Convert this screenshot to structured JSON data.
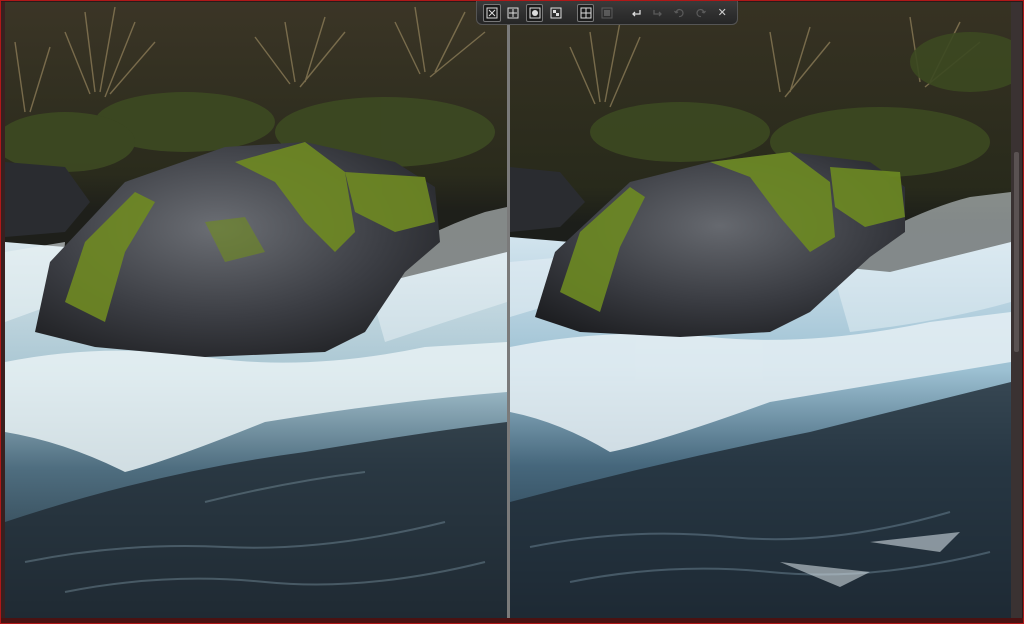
{
  "window": {
    "accent_color": "#b01818"
  },
  "toolbar": {
    "buttons": [
      {
        "id": "fit",
        "icon": "fit-view-icon",
        "boxed": true,
        "enabled": true
      },
      {
        "id": "zoom-100",
        "icon": "actual-size-icon",
        "boxed": false,
        "enabled": true
      },
      {
        "id": "single",
        "icon": "single-view-icon",
        "boxed": true,
        "enabled": true
      },
      {
        "id": "compare",
        "icon": "compare-view-icon",
        "boxed": false,
        "enabled": true
      },
      {
        "id": "split",
        "icon": "split-view-icon",
        "boxed": true,
        "enabled": true
      },
      {
        "id": "grid",
        "icon": "grid-view-icon",
        "boxed": false,
        "enabled": false
      },
      {
        "id": "prev",
        "icon": "previous-icon",
        "boxed": false,
        "enabled": true
      },
      {
        "id": "next",
        "icon": "next-icon",
        "boxed": false,
        "enabled": false
      },
      {
        "id": "undo",
        "icon": "undo-icon",
        "boxed": false,
        "enabled": false
      },
      {
        "id": "redo",
        "icon": "redo-icon",
        "boxed": false,
        "enabled": false
      }
    ],
    "close_glyph": "✕"
  },
  "panes": [
    {
      "id": "left",
      "content": "photo-river-rock-before"
    },
    {
      "id": "right",
      "content": "photo-river-rock-after"
    }
  ]
}
